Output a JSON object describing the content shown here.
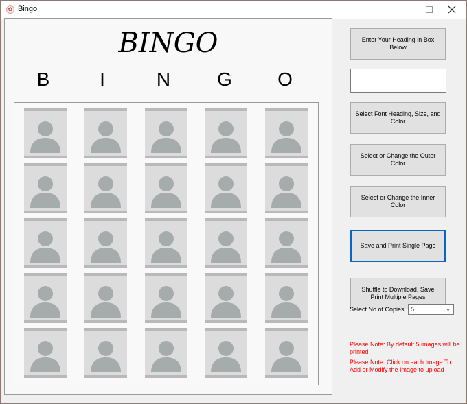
{
  "window": {
    "title": "Bingo"
  },
  "card": {
    "title": "BINGO",
    "letters": [
      "B",
      "I",
      "N",
      "G",
      "O"
    ],
    "cells": [
      [
        "person-placeholder",
        "person-placeholder",
        "person-placeholder",
        "person-placeholder",
        "person-placeholder"
      ],
      [
        "person-placeholder",
        "person-placeholder",
        "person-placeholder",
        "person-placeholder",
        "person-placeholder"
      ],
      [
        "person-placeholder",
        "person-placeholder",
        "person-placeholder",
        "person-placeholder",
        "person-placeholder"
      ],
      [
        "person-placeholder",
        "person-placeholder",
        "person-placeholder",
        "person-placeholder",
        "person-placeholder"
      ],
      [
        "person-placeholder",
        "person-placeholder",
        "person-placeholder",
        "person-placeholder",
        "person-placeholder"
      ]
    ]
  },
  "panel": {
    "heading_btn": "Enter Your Heading in Box Below",
    "heading_value": "",
    "font_btn": "Select Font Heading, Size, and Color",
    "outer_btn": "Select or Change the Outer Color",
    "inner_btn": "Select or Change the Inner Color",
    "save_btn": "Save and Print Single Page",
    "shuffle_btn": "Shuffle to Download, Save  Print Multiple Pages",
    "copies_label": "Select No of Copies.",
    "copies_value": "5",
    "note1": "Please Note: By default 5 images will be printed",
    "note2": "Please Note: Click on each Image To Add or Modify the Image to upload"
  },
  "colors": {
    "focus_border": "#0a64c8",
    "note_text": "#ff0000",
    "placeholder_bg": "#dcdcdc",
    "placeholder_figure": "#a6abab"
  }
}
